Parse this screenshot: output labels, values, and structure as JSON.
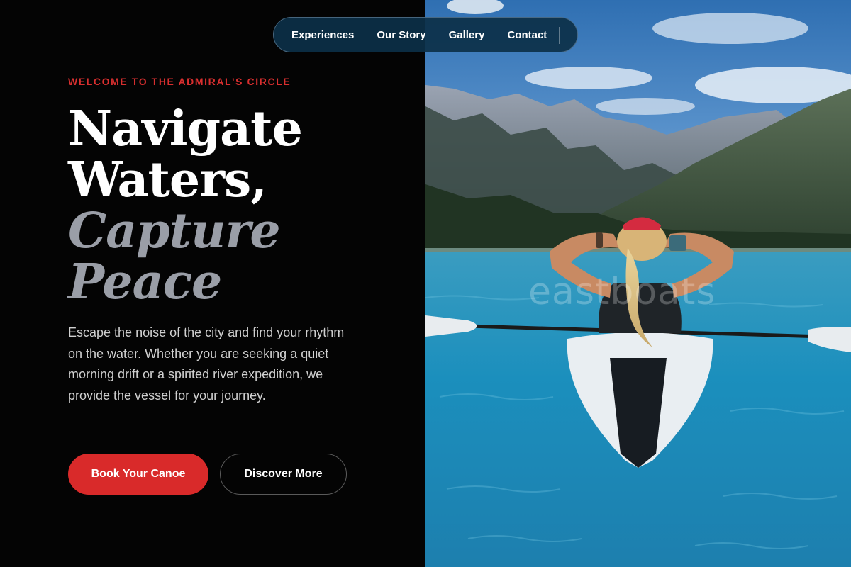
{
  "nav": {
    "items": [
      {
        "label": "Experiences"
      },
      {
        "label": "Our Story"
      },
      {
        "label": "Gallery"
      },
      {
        "label": "Contact"
      }
    ]
  },
  "hero": {
    "eyebrow": "WELCOME TO THE ADMIRAL'S CIRCLE",
    "headline": {
      "line1": "Navigate",
      "line2": "Waters,",
      "line3": "Capture",
      "line4": "Peace"
    },
    "body": "Escape the noise of the city and find your rhythm on the water. Whether you are seeking a quiet morning drift or a spirited river expedition, we provide the vessel for your journey.",
    "primary_button": "Book Your Canoe",
    "secondary_button": "Discover More"
  },
  "image": {
    "watermark": "eastboats"
  },
  "colors": {
    "accent": "#d92a2a",
    "background": "#040404",
    "nav_bg": "#0c3048",
    "headline_accent": "#9a9ea7"
  }
}
